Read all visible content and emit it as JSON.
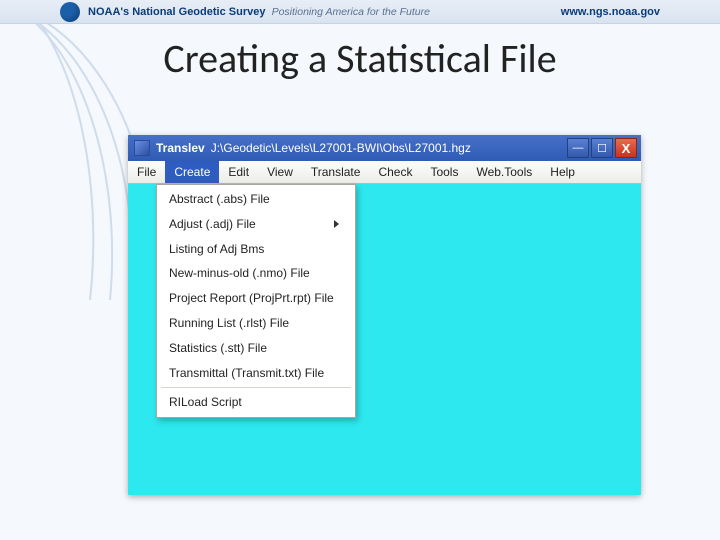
{
  "header": {
    "brand_prefix": "NOAA's",
    "brand_main": "National Geodetic Survey",
    "tagline": "Positioning America for the Future",
    "url": "www.ngs.noaa.gov"
  },
  "slide_title": "Creating a Statistical File",
  "window": {
    "app_name": "Translev",
    "path": "J:\\Geodetic\\Levels\\L27001-BWI\\Obs\\L27001.hgz",
    "controls": {
      "minimize": "―",
      "maximize": "☐",
      "close": "X"
    }
  },
  "menubar": {
    "items": [
      "File",
      "Create",
      "Edit",
      "View",
      "Translate",
      "Check",
      "Tools",
      "Web.Tools",
      "Help"
    ],
    "active_index": 1
  },
  "dropdown": {
    "items": [
      {
        "label": "Abstract (.abs) File"
      },
      {
        "label": "Adjust (.adj) File",
        "submenu": true
      },
      {
        "label": "Listing of Adj Bms"
      },
      {
        "label": "New-minus-old (.nmo) File"
      },
      {
        "label": "Project Report (ProjPrt.rpt) File"
      },
      {
        "label": "Running List (.rlst) File"
      },
      {
        "label": "Statistics (.stt) File"
      },
      {
        "label": "Transmittal (Transmit.txt) File"
      },
      {
        "separator": true
      },
      {
        "label": "RILoad Script"
      }
    ]
  }
}
